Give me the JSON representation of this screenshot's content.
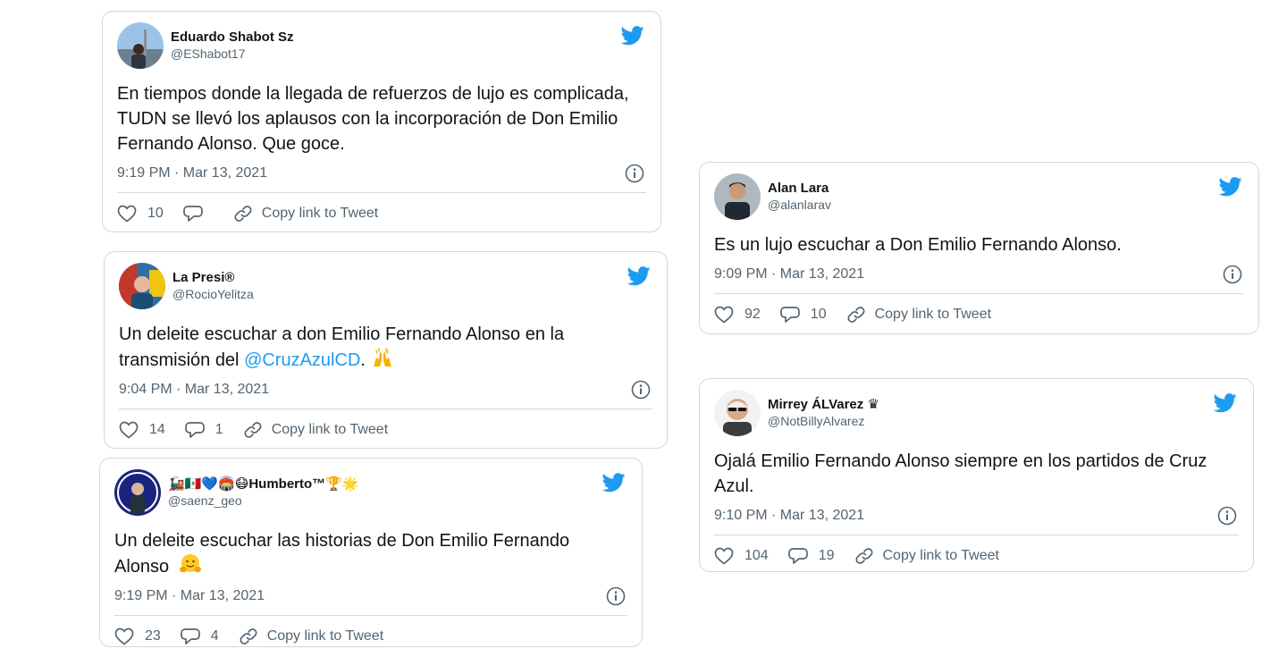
{
  "colors": {
    "twitter_blue": "#1d9bf0",
    "text": "#0f1419",
    "muted": "#536471",
    "border": "#cfd9de"
  },
  "tweets": [
    {
      "display_name": "Eduardo Shabot Sz",
      "handle": "@EShabot17",
      "text": "En tiempos donde la llegada de refuerzos de lujo es complicada, TUDN se llevó los aplausos con la incorporación de Don Emilio Fernando Alonso. Que goce.",
      "timestamp": "9:19 PM · Mar 13, 2021",
      "likes": "10",
      "replies": "",
      "copy_label": "Copy link to Tweet"
    },
    {
      "display_name": "La Presi®",
      "handle": "@RocioYelitza",
      "text_before": "Un deleite escuchar a don Emilio Fernando Alonso en la transmisión del ",
      "mention": "@CruzAzulCD",
      "text_after": ". ",
      "emoji": "raising-hands",
      "timestamp": "9:04 PM · Mar 13, 2021",
      "likes": "14",
      "replies": "1",
      "copy_label": "Copy link to Tweet"
    },
    {
      "display_name": "🚂🇲🇽💙🏟️😷Humberto™🏆🌟",
      "handle": "@saenz_geo",
      "text": "Un deleite escuchar las historias de Don Emilio Fernando Alonso ",
      "emoji": "hugging-face",
      "timestamp": "9:19 PM · Mar 13, 2021",
      "likes": "23",
      "replies": "4",
      "copy_label": "Copy link to Tweet"
    },
    {
      "display_name": "Alan Lara",
      "handle": "@alanlarav",
      "text": "Es un lujo escuchar a Don Emilio Fernando Alonso.",
      "timestamp": "9:09 PM · Mar 13, 2021",
      "likes": "92",
      "replies": "10",
      "copy_label": "Copy link to Tweet"
    },
    {
      "display_name": "Mirrey ÁLVarez ♛",
      "handle": "@NotBillyAlvarez",
      "text": "Ojalá Emilio Fernando Alonso siempre en los partidos de Cruz Azul.",
      "timestamp": "9:10 PM · Mar 13, 2021",
      "likes": "104",
      "replies": "19",
      "copy_label": "Copy link to Tweet"
    }
  ]
}
